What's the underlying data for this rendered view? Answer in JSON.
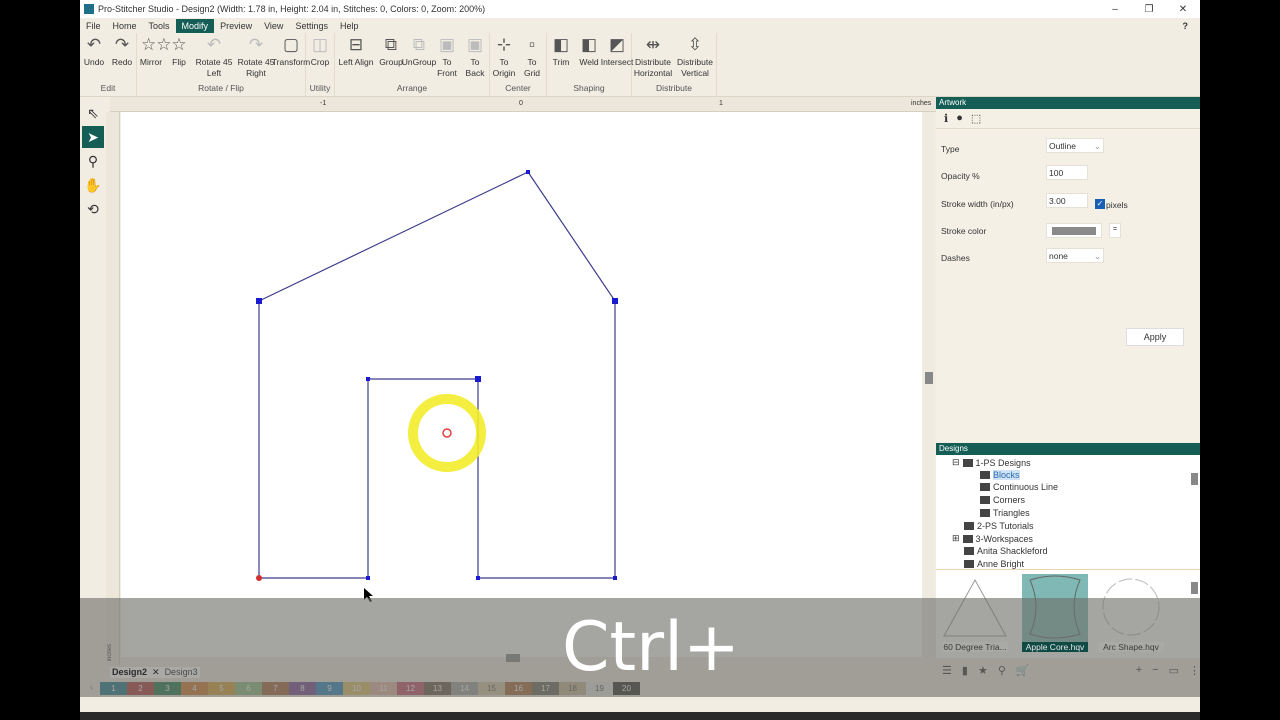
{
  "window": {
    "title": "Pro-Stitcher Studio - Design2 (Width: 1.78 in, Height: 2.04 in, Stitches: 0, Colors: 0, Zoom: 200%)",
    "minimize": "–",
    "maximize": "❐",
    "close": "✕",
    "help": "?"
  },
  "menu": [
    "File",
    "Home",
    "Tools",
    "Modify",
    "Preview",
    "View",
    "Settings",
    "Help"
  ],
  "ribbon": [
    {
      "group": "Edit",
      "buttons": [
        {
          "label": "Undo",
          "icon": "↶"
        },
        {
          "label": "Redo",
          "icon": "↷"
        }
      ]
    },
    {
      "group": "Rotate / Flip",
      "buttons": [
        {
          "label": "Mirror",
          "icon": "☆☆"
        },
        {
          "label": "Flip",
          "icon": "☆"
        },
        {
          "label": "Rotate 45 Left",
          "icon": "↶"
        },
        {
          "label": "Rotate 45 Right",
          "icon": "↷"
        },
        {
          "label": "Transform",
          "icon": "▢"
        }
      ]
    },
    {
      "group": "Utility",
      "buttons": [
        {
          "label": "Crop",
          "icon": "◫"
        }
      ]
    },
    {
      "group": "Arrange",
      "buttons": [
        {
          "label": "Left Align",
          "icon": "⊟"
        },
        {
          "label": "Group",
          "icon": "⧉"
        },
        {
          "label": "UnGroup",
          "icon": "⧉"
        },
        {
          "label": "To Front",
          "icon": "▣"
        },
        {
          "label": "To Back",
          "icon": "▣"
        }
      ]
    },
    {
      "group": "Center",
      "buttons": [
        {
          "label": "To Origin",
          "icon": "⊹"
        },
        {
          "label": "To Grid",
          "icon": "▫"
        }
      ]
    },
    {
      "group": "Shaping",
      "buttons": [
        {
          "label": "Trim",
          "icon": "◧"
        },
        {
          "label": "Weld",
          "icon": "◧"
        },
        {
          "label": "Intersect",
          "icon": "◩"
        }
      ]
    },
    {
      "group": "Distribute",
      "buttons": [
        {
          "label": "Distribute Horizontal",
          "icon": "⇹"
        },
        {
          "label": "Distribute Vertical",
          "icon": "⇳"
        }
      ]
    }
  ],
  "ruler": {
    "ticks": [
      "-1",
      "0",
      "1"
    ],
    "unit": "inches",
    "vunit": "inches"
  },
  "artwork": {
    "title": "Artwork",
    "type_label": "Type",
    "type_value": "Outline",
    "opacity_label": "Opacity %",
    "opacity_value": "100",
    "stroke_width_label": "Stroke width (in/px)",
    "stroke_width_value": "3.00",
    "pixels_label": "pixels",
    "pixels_checked": true,
    "stroke_color_label": "Stroke color",
    "stroke_color": "#8a8a8a",
    "dashes_label": "Dashes",
    "dashes_value": "none",
    "apply": "Apply"
  },
  "designs": {
    "title": "Designs",
    "tree": [
      "1-PS Designs",
      "Blocks",
      "Continuous Line",
      "Corners",
      "Triangles",
      "2-PS Tutorials",
      "3-Workspaces",
      "Anita Shackleford",
      "Anne Bright"
    ],
    "thumbs": [
      "60 Degree Tria...",
      "Apple Core.hqv",
      "Arc Shape.hqv"
    ]
  },
  "tabs": [
    "Design2",
    "Design3"
  ],
  "palette": [
    {
      "n": "1",
      "c": "#1f7a8c"
    },
    {
      "n": "2",
      "c": "#b03a3a"
    },
    {
      "n": "3",
      "c": "#1e7a4a"
    },
    {
      "n": "4",
      "c": "#d67a2a"
    },
    {
      "n": "5",
      "c": "#d9a23a"
    },
    {
      "n": "6",
      "c": "#8fbf80"
    },
    {
      "n": "7",
      "c": "#a8683a"
    },
    {
      "n": "8",
      "c": "#7a4a9a"
    },
    {
      "n": "9",
      "c": "#2a8ac0"
    },
    {
      "n": "10",
      "c": "#e3c36a"
    },
    {
      "n": "11",
      "c": "#e8b8a8"
    },
    {
      "n": "12",
      "c": "#c9506a"
    },
    {
      "n": "13",
      "c": "#6a5a4a"
    },
    {
      "n": "14",
      "c": "#a0a0a0"
    },
    {
      "n": "15",
      "c": "#d8c8a8"
    },
    {
      "n": "16",
      "c": "#a86a3a"
    },
    {
      "n": "17",
      "c": "#6a6a5a"
    },
    {
      "n": "18",
      "c": "#c8b898"
    },
    {
      "n": "19",
      "c": "#e8e8e8"
    },
    {
      "n": "20",
      "c": "#303030"
    }
  ],
  "overlay_text": "Ctrl+"
}
